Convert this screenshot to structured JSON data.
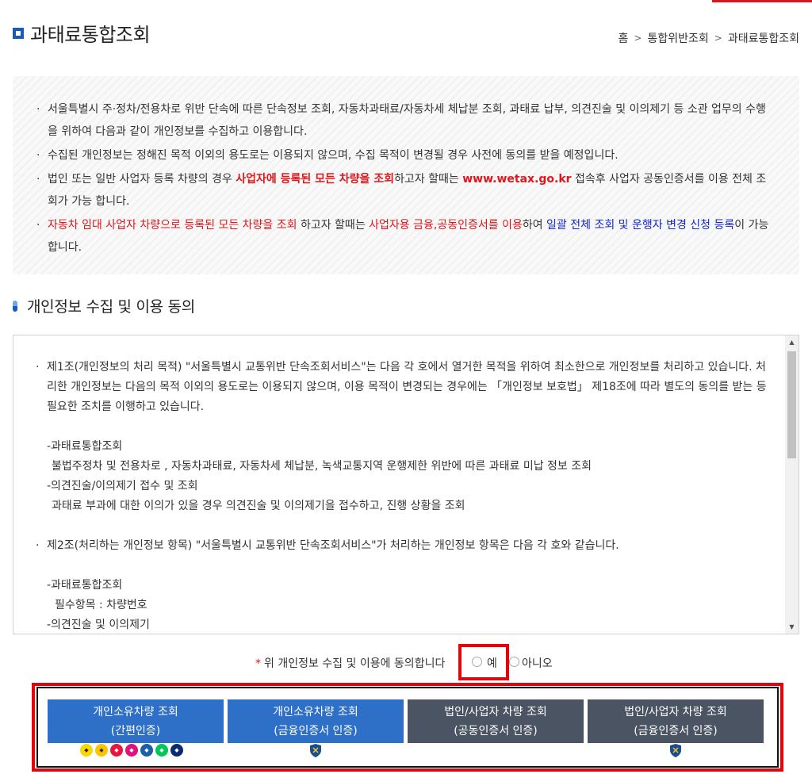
{
  "header": {
    "title": "과태료통합조회",
    "breadcrumb": [
      "홈",
      "통합위반조회",
      "과태료통합조회"
    ]
  },
  "notice": {
    "item1": "서울특별시 주·정차/전용차로 위반 단속에 따른 단속정보 조회, 자동차과태료/자동차세 체납분 조회, 과태료 납부, 의견진술 및 이의제기 등 소관 업무의 수행을 위하여 다음과 같이 개인정보를 수집하고 이용합니다.",
    "item2": "수집된 개인정보는 정해진 목적 이외의 용도로는 이용되지 않으며, 수집 목적이 변경될 경우 사전에 동의를 받을 예정입니다.",
    "item3_a": "법인 또는 일반 사업자 등록 차량의 경우 ",
    "item3_b": "사업자에 등록된 모든 차량을 조회",
    "item3_c": "하고자 할때는 ",
    "item3_d": "www.wetax.go.kr",
    "item3_e": " 접속후 사업자 공동인증서를 이용 전체 조회가 가능 합니다.",
    "item4_a": "자동차 임대 사업자 차량으로 등록된 모든 차량을 조회",
    "item4_b": " 하고자 할때는 ",
    "item4_c": "사업자용 금융,공동인증서를 이용",
    "item4_d": "하여 ",
    "item4_e": "일괄 전체 조회 및 운행자 변경 신청 등록",
    "item4_f": "이 가능합니다."
  },
  "consent": {
    "title": "개인정보 수집 및 이용 동의",
    "art1": "제1조(개인정보의 처리 목적) \"서울특별시 교통위반 단속조회서비스\"는 다음 각 호에서 열거한 목적을 위하여 최소한으로 개인정보를 처리하고 있습니다. 처리한 개인정보는 다음의 목적 이외의 용도로는 이용되지 않으며, 이용 목적이 변경되는 경우에는 「개인정보 보호법」 제18조에 따라 별도의 동의를 받는 등 필요한 조치를 이행하고 있습니다.",
    "art1_s1": "-과태료통합조회",
    "art1_s1d": "불법주정차 및 전용차로 , 자동차과태료, 자동차세 체납분, 녹색교통지역 운행제한 위반에 따른 과태료 미납 정보 조회",
    "art1_s2": "-의견진술/이의제기 접수 및 조회",
    "art1_s2d": "과태료 부과에 대한 이의가 있을 경우 의견진술 및 이의제기을 접수하고, 진행 상황을 조회",
    "art2": "제2조(처리하는 개인정보 항목) \"서울특별시 교통위반 단속조회서비스\"가 처리하는 개인정보 항목은 다음 각 호와 같습니다.",
    "art2_s1": "-과태료통합조회",
    "art2_s1d": "필수항목 : 차량번호",
    "art2_s2": "-의견진술 및 이의제기"
  },
  "agree": {
    "star": "*",
    "label": "위 개인정보 수집 및 이용에 동의합니다",
    "yes": "예",
    "no": "아니오"
  },
  "buttons": [
    {
      "line1": "개인소유차량 조회",
      "line2": "(간편인증)"
    },
    {
      "line1": "개인소유차량 조회",
      "line2": "(금융인증서 인증)"
    },
    {
      "line1": "법인/사업자 차량 조회",
      "line2": "(공동인증서 인증)"
    },
    {
      "line1": "법인/사업자 차량 조회",
      "line2": "(금융인증서 인증)"
    }
  ],
  "colors": {
    "accent_blue": "#2e6fc7",
    "dark_gray": "#4a5462",
    "highlight_red": "#e0060c"
  }
}
